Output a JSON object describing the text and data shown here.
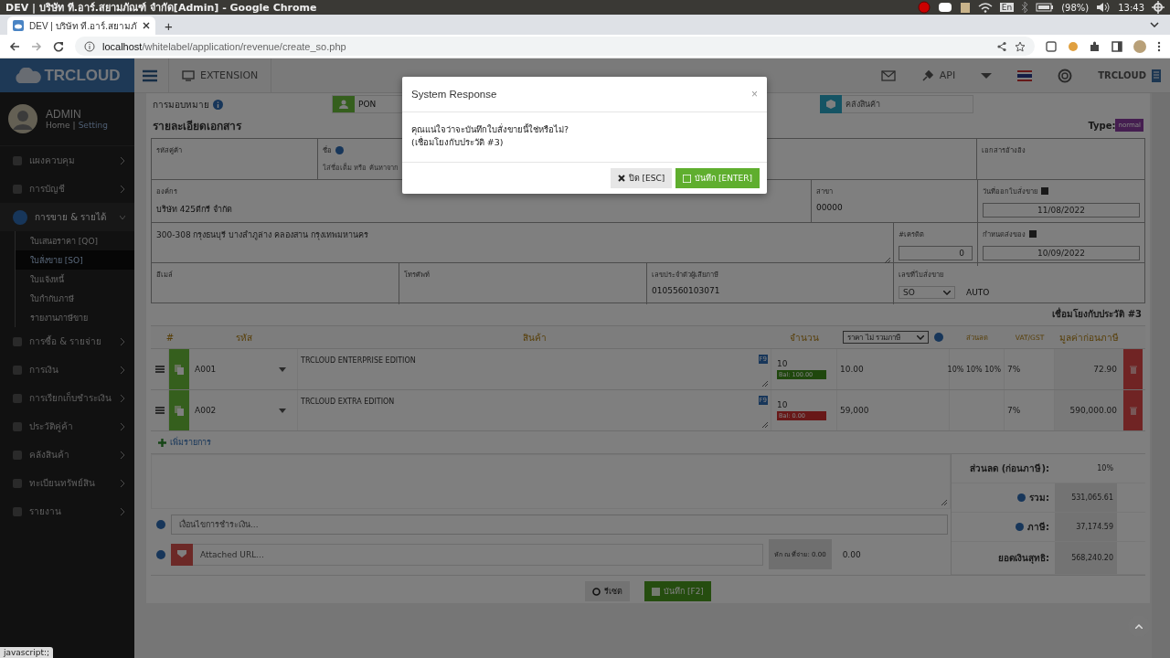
{
  "os_bar": {
    "title": "DEV | บริษัท ที.อาร์.สยามภัณฑ์ จำกัด[Admin] - Google Chrome",
    "keyboard": "En",
    "battery": "(98%)",
    "time": "13:43"
  },
  "browser": {
    "tab_title": "DEV | บริษัท ที.อาร์.สยามภั",
    "new_tab": "+",
    "url_host": "localhost",
    "url_path": "/whitelabel/application/revenue/create_so.php",
    "status_url": "javascript:;"
  },
  "app_header": {
    "logo": "TRCLOUD",
    "extension": "EXTENSION",
    "api": "API",
    "company": "TRCLOUD"
  },
  "user": {
    "name": "ADMIN",
    "home": "Home",
    "separator": "|",
    "setting": "Setting"
  },
  "sidebar": {
    "items": [
      {
        "label": "แผงควบคุม",
        "selected": false,
        "expanded": false
      },
      {
        "label": "การบัญชี",
        "selected": false,
        "expanded": false
      },
      {
        "label": "การขาย & รายได้",
        "selected": true,
        "expanded": true,
        "children": [
          {
            "label": "ใบเสนอราคา [QO]",
            "selected": false
          },
          {
            "label": "ใบสั่งขาย [SO]",
            "selected": true
          },
          {
            "label": "ใบแจ้งหนี้",
            "selected": false
          },
          {
            "label": "ใบกำกับภาษี",
            "selected": false
          },
          {
            "label": "รายงานภาษีขาย",
            "selected": false
          }
        ]
      },
      {
        "label": "การซื้อ & รายจ่าย",
        "selected": false,
        "expanded": false
      },
      {
        "label": "การเงิน",
        "selected": false,
        "expanded": false
      },
      {
        "label": "การเรียกเก็บชำระเงิน",
        "selected": false,
        "expanded": false
      },
      {
        "label": "ประวัติคู่ค้า",
        "selected": false,
        "expanded": false
      },
      {
        "label": "คลังสินค้า",
        "selected": false,
        "expanded": false
      },
      {
        "label": "ทะเบียนทรัพย์สิน",
        "selected": false,
        "expanded": false
      },
      {
        "label": "รายงาน",
        "selected": false,
        "expanded": false
      }
    ]
  },
  "assignment": {
    "label": "การมอบหมาย",
    "salesperson": "PON",
    "warehouse_placeholder": "คลังสินค้า"
  },
  "document": {
    "title": "รายละเอียดเอกสาร",
    "type_label": "Type:",
    "type_badge": "normal",
    "customer_code_label": "รหัสคู่ค้า",
    "name_label": "ชื่อ",
    "name_placeholder": "ใส่ชื่อเต็ม หรือ ค้นหาจาก",
    "reference_label": "เอกสารอ้างอิง",
    "organization_label": "องค์กร",
    "organization": "บริษัท 425ดีกรี จำกัด",
    "branch_label": "สาขา",
    "branch": "00000",
    "issue_date_label": "วันที่ออกใบสั่งขาย",
    "issue_date": "11/08/2022",
    "address": "300-308 กรุงธนบุรี บางลำภูล่าง คลองสาน กรุงเทพมหานคร",
    "credit_label": "#เครดิต",
    "credit": "0",
    "due_date_label": "กำหนดส่งของ",
    "due_date": "10/09/2022",
    "email_label": "อีเมล์",
    "phone_label": "โทรศัพท์",
    "tax_id_label": "เลขประจำตัวผู้เสียภาษี",
    "tax_id": "0105560103071",
    "so_number_label": "เลขที่ใบสั่งขาย",
    "so_prefix": "SO",
    "so_number": "AUTO",
    "link_note": "เชื่อมโยงกับประวัติ #3"
  },
  "items_table": {
    "columns": {
      "index": "#",
      "code": "รหัส",
      "product": "สินค้า",
      "quantity": "จำนวน",
      "price_mode": "ราคา ไม่ รวมภาษี",
      "discount": "ส่วนลด",
      "vat": "VAT/GST",
      "amount": "มูลค่าก่อนภาษี"
    },
    "rows": [
      {
        "code": "A001",
        "product": "TRCLOUD ENTERPRISE EDITION",
        "badge": "F9",
        "quantity": "10",
        "balance": "Bal: 100.00",
        "in_stock": true,
        "price": "10.00",
        "discount": "10% 10% 10%",
        "vat": "7%",
        "amount": "72.90"
      },
      {
        "code": "A002",
        "product": "TRCLOUD EXTRA EDITION",
        "badge": "F9",
        "quantity": "10",
        "balance": "Bal: 0.00",
        "in_stock": false,
        "price": "59,000",
        "vat": "7%",
        "amount": "590,000.00"
      }
    ],
    "add_item": "เพิ่มรายการ"
  },
  "summary": {
    "discount_label": "ส่วนลด (ก่อนภาษี):",
    "discount": "10%",
    "total_label": "รวม:",
    "total": "531,065.61",
    "tax_label": "ภาษี:",
    "tax": "37,174.59",
    "net_label": "ยอดเงินสุทธิ:",
    "net": "568,240.20",
    "payment_terms_placeholder": "เงื่อนไขการชำระเงิน...",
    "attachment_placeholder": "Attached URL...",
    "withholding_label": "หัก ณ ที่จ่าย: 0.00",
    "withholding": "0.00"
  },
  "actions": {
    "reset": "รีเซต",
    "save": "บันทึก [F2]"
  },
  "modal": {
    "title": "System Response",
    "close": "×",
    "message": "คุณแน่ใจว่าจะบันทึกใบสั่งขายนี้ใช่หรือไม่?",
    "note": "(เชื่อมโยงกับประวัติ #3)",
    "cancel": "ปิด [ESC]",
    "confirm": "บันทึก [ENTER]"
  }
}
